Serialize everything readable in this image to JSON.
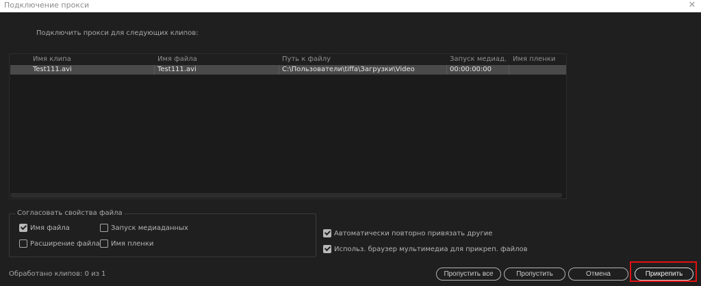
{
  "window": {
    "title": "Подключение прокси"
  },
  "subtitle": "Подключить прокси для следующих клипов:",
  "table": {
    "columns": [
      "Имя клипа",
      "Имя файла",
      "Путь к файлу",
      "Запуск медиад...",
      "Имя пленки"
    ],
    "rows": [
      [
        "Test111.avi",
        "Test111.avi",
        "C:\\Пользователи\\tiffa\\Загрузки\\Video",
        "00:00:00:00",
        ""
      ]
    ]
  },
  "match_group": {
    "legend": "Согласовать свойства файла",
    "options": [
      {
        "label": "Имя файла",
        "checked": true
      },
      {
        "label": "Запуск медиаданных",
        "checked": false
      },
      {
        "label": "Расширение файла",
        "checked": false
      },
      {
        "label": "Имя пленки",
        "checked": false
      }
    ]
  },
  "right_options": [
    {
      "label": "Автоматически повторно привязать другие",
      "checked": true
    },
    {
      "label": "Использ. браузер мультимедиа для прикреп. файлов",
      "checked": true
    }
  ],
  "status": "Обработано клипов: 0 из 1",
  "buttons": {
    "skip_all": "Пропустить все",
    "skip": "Пропустить",
    "cancel": "Отмена",
    "attach": "Прикрепить"
  },
  "colors": {
    "highlight": "#e31212"
  }
}
